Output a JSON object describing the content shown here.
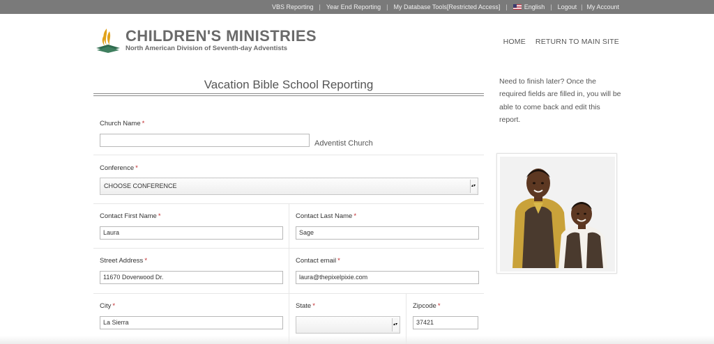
{
  "topbar": {
    "links": [
      "VBS Reporting",
      "Year End Reporting",
      "My Database Tools[Restricted Access]"
    ],
    "language": "English",
    "logout": "Logout",
    "account": "My Account"
  },
  "logo": {
    "title": "CHILDREN'S MINISTRIES",
    "subtitle": "North American Division of Seventh-day Adventists"
  },
  "nav": {
    "home": "HOME",
    "return": "RETURN TO MAIN SITE"
  },
  "form": {
    "title": "Vacation Bible School Reporting",
    "church_name": {
      "label": "Church Name",
      "value": "",
      "suffix": "Adventist Church"
    },
    "conference": {
      "label": "Conference",
      "selected": "CHOOSE CONFERENCE"
    },
    "first_name": {
      "label": "Contact First Name",
      "value": "Laura"
    },
    "last_name": {
      "label": "Contact Last Name",
      "value": "Sage"
    },
    "street": {
      "label": "Street Address",
      "value": "11670 Doverwood Dr."
    },
    "email": {
      "label": "Contact email",
      "value": "laura@thepixelpixie.com"
    },
    "city": {
      "label": "City",
      "value": "La Sierra"
    },
    "state": {
      "label": "State",
      "selected": ""
    },
    "zip": {
      "label": "Zipcode",
      "value": "37421"
    },
    "required_mark": "*"
  },
  "sidebar": {
    "note": "Need to finish later? Once the required fields are filled in, you will be able to come back and edit this report."
  },
  "colors": {
    "topbar": "#7a7a7a",
    "required": "#c0282a",
    "logo_gold": "#e1a21a",
    "logo_green": "#2f6b4e"
  }
}
